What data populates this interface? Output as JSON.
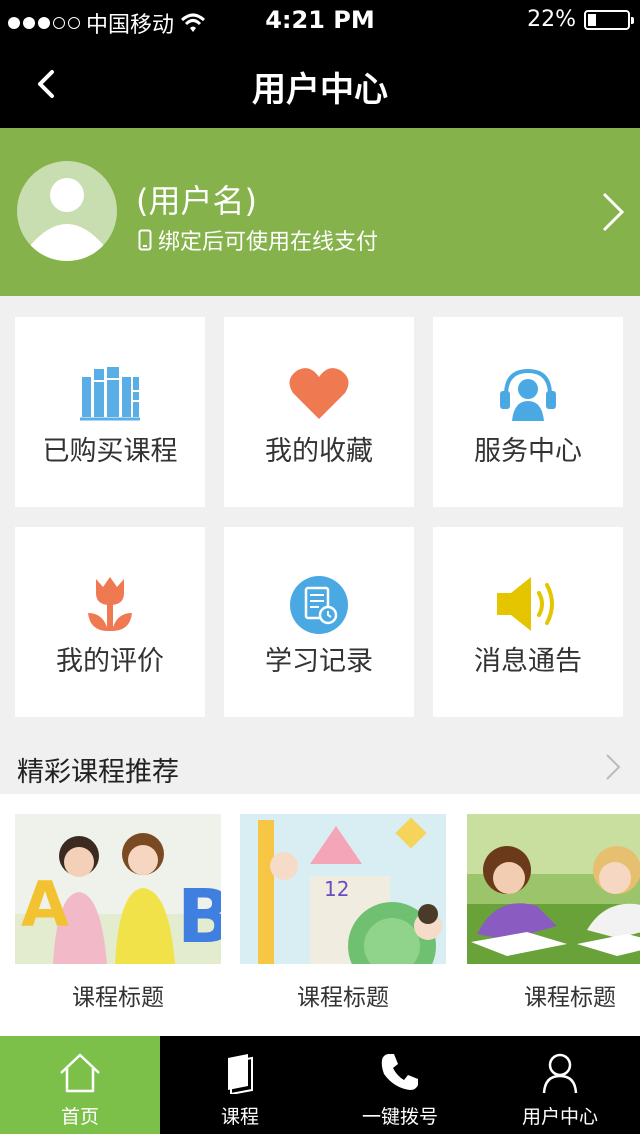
{
  "status": {
    "carrier": "中国移动",
    "time": "4:21 PM",
    "battery": "22%"
  },
  "nav": {
    "title": "用户中心"
  },
  "profile": {
    "username": "(用户名)",
    "bind_tip": "绑定后可使用在线支付"
  },
  "grid": [
    {
      "label": "已购买课程",
      "icon": "books-icon",
      "color": "#5aaee6"
    },
    {
      "label": "我的收藏",
      "icon": "heart-icon",
      "color": "#ef7a52"
    },
    {
      "label": "服务中心",
      "icon": "headset-icon",
      "color": "#4aa9e2"
    },
    {
      "label": "我的评价",
      "icon": "tulip-icon",
      "color": "#ef7a52"
    },
    {
      "label": "学习记录",
      "icon": "study-record-icon",
      "color": "#4aa9e2"
    },
    {
      "label": "消息通告",
      "icon": "speaker-icon",
      "color": "#e5c400"
    }
  ],
  "recommend": {
    "title": "精彩课程推荐",
    "courses": [
      {
        "title": "课程标题"
      },
      {
        "title": "课程标题"
      },
      {
        "title": "课程标题"
      }
    ]
  },
  "tabs": [
    {
      "label": "首页",
      "icon": "home-icon"
    },
    {
      "label": "课程",
      "icon": "book-icon"
    },
    {
      "label": "一键拨号",
      "icon": "phone-icon"
    },
    {
      "label": "用户中心",
      "icon": "user-icon"
    }
  ],
  "colors": {
    "brand_green": "#85b24a",
    "tab_active": "#7cc04a"
  }
}
